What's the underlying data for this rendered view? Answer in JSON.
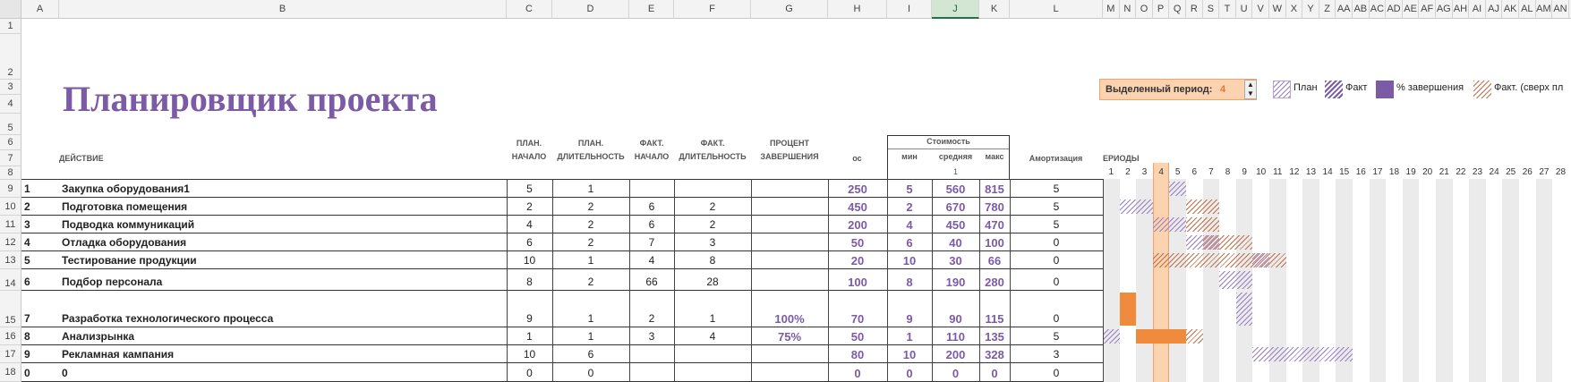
{
  "title": "Планировщик проекта",
  "columns": [
    "A",
    "B",
    "C",
    "D",
    "E",
    "F",
    "G",
    "H",
    "I",
    "J",
    "K",
    "L",
    "M",
    "N",
    "O",
    "P",
    "Q",
    "R",
    "S",
    "T",
    "U",
    "V",
    "W",
    "X",
    "Y",
    "Z",
    "AA",
    "AB",
    "AC",
    "AD",
    "AE",
    "AF",
    "AG",
    "AH",
    "AI",
    "AJ",
    "AK",
    "AL",
    "AM",
    "AN"
  ],
  "selected_column": "J",
  "row_numbers": [
    "1",
    "2",
    "3",
    "4",
    "5",
    "6",
    "7",
    "8",
    "9",
    "10",
    "11",
    "12",
    "13",
    "14",
    "15",
    "16",
    "17",
    "18"
  ],
  "headers": {
    "action": "ДЕЙСТВИЕ",
    "plan_start_1": "ПЛАН.",
    "plan_start_2": "НАЧАЛО",
    "plan_dur_1": "ПЛАН.",
    "plan_dur_2": "ДЛИТЕЛЬНОСТЬ",
    "fact_start_1": "ФАКТ.",
    "fact_start_2": "НАЧАЛО",
    "fact_dur_1": "ФАКТ.",
    "fact_dur_2": "ДЛИТЕЛЬНОСТЬ",
    "pct_1": "ПРОЦЕНТ",
    "pct_2": "ЗАВЕРШЕНИЯ",
    "os": "ос",
    "cost": "Стоимость",
    "min": "мин",
    "avg": "средняя",
    "max": "макс",
    "avg_index": "1",
    "amort": "Амортизация",
    "periods": "ЕРИОДЫ"
  },
  "period_control": {
    "label": "Выделенный период:",
    "value": "4"
  },
  "legend": {
    "plan": "План",
    "fact": "Факт",
    "pct": "% завершения",
    "fact_over": "Факт. (сверх пл"
  },
  "colors": {
    "accent": "#7b5ba6",
    "highlight": "#f5a16a",
    "orange_solid": "#f08a3c"
  },
  "periods": [
    "1",
    "2",
    "3",
    "4",
    "5",
    "6",
    "7",
    "8",
    "9",
    "10",
    "11",
    "12",
    "13",
    "14",
    "15",
    "16",
    "17",
    "18",
    "19",
    "20",
    "21",
    "22",
    "23",
    "24",
    "25",
    "26",
    "27",
    "28"
  ],
  "rows": [
    {
      "n": "1",
      "name": "Закупка оборудования1",
      "ps": "5",
      "pd": "1",
      "fs": "",
      "fd": "",
      "pct": "",
      "os": "250",
      "min": "5",
      "avg": "560",
      "max": "815",
      "am": "5"
    },
    {
      "n": "2",
      "name": "Подготовка помещения",
      "ps": "2",
      "pd": "2",
      "fs": "6",
      "fd": "2",
      "pct": "",
      "os": "450",
      "min": "2",
      "avg": "670",
      "max": "780",
      "am": "5"
    },
    {
      "n": "3",
      "name": "Подводка коммуникаций",
      "ps": "4",
      "pd": "2",
      "fs": "6",
      "fd": "2",
      "pct": "",
      "os": "200",
      "min": "4",
      "avg": "450",
      "max": "470",
      "am": "5"
    },
    {
      "n": "4",
      "name": "Отладка оборудования",
      "ps": "6",
      "pd": "2",
      "fs": "7",
      "fd": "3",
      "pct": "",
      "os": "50",
      "min": "6",
      "avg": "40",
      "max": "100",
      "am": "0"
    },
    {
      "n": "5",
      "name": "Тестирование продукции",
      "ps": "10",
      "pd": "1",
      "fs": "4",
      "fd": "8",
      "pct": "",
      "os": "20",
      "min": "10",
      "avg": "30",
      "max": "66",
      "am": "0"
    },
    {
      "n": "6",
      "name": "Подбор персонала",
      "ps": "8",
      "pd": "2",
      "fs": "66",
      "fd": "28",
      "pct": "",
      "os": "100",
      "min": "8",
      "avg": "190",
      "max": "280",
      "am": "0"
    },
    {
      "n": "7",
      "name": "Разработка технологического процесса",
      "ps": "9",
      "pd": "1",
      "fs": "2",
      "fd": "1",
      "pct": "100%",
      "os": "70",
      "min": "9",
      "avg": "90",
      "max": "115",
      "am": "0"
    },
    {
      "n": "8",
      "name": "Анализрынка",
      "ps": "1",
      "pd": "1",
      "fs": "3",
      "fd": "4",
      "pct": "75%",
      "os": "50",
      "min": "1",
      "avg": "110",
      "max": "135",
      "am": "5"
    },
    {
      "n": "9",
      "name": "Рекламная кампания",
      "ps": "10",
      "pd": "6",
      "fs": "",
      "fd": "",
      "pct": "",
      "os": "80",
      "min": "10",
      "avg": "200",
      "max": "328",
      "am": "3"
    },
    {
      "n": "0",
      "name": "0",
      "ps": "0",
      "pd": "0",
      "fs": "",
      "fd": "",
      "pct": "",
      "os": "0",
      "min": "0",
      "avg": "0",
      "max": "0",
      "am": "0"
    }
  ]
}
